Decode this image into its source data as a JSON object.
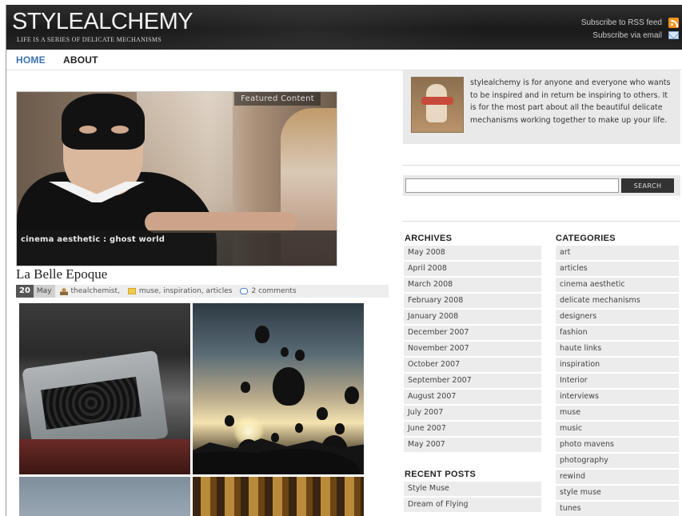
{
  "header": {
    "logo": "STYLEALCHEMY",
    "tagline": "LIFE IS A SERIES OF DELICATE MECHANISMS",
    "subscribe_rss": "Subscribe to RSS feed",
    "subscribe_email": "Subscribe via email",
    "icons": [
      "rss-icon",
      "mail-icon"
    ]
  },
  "nav": {
    "items": [
      {
        "label": "HOME"
      },
      {
        "label": "ABOUT"
      }
    ]
  },
  "featured": {
    "label": "Featured Content",
    "caption": "cinema aesthetic : ghost world"
  },
  "post": {
    "title": "La Belle Epoque",
    "day": "20",
    "month": "May",
    "author": "thealchemist,",
    "categories": "muse, inspiration, articles",
    "comments": "2 comments"
  },
  "sidebar": {
    "about_text": "stylealchemy is for anyone and everyone who wants to be inspired and in return be inspiring to others. It is for the most part about all the beautiful delicate mechanisms working together to make up your life.",
    "search": {
      "value": "",
      "placeholder": "",
      "button_label": "SEARCH"
    },
    "archives": {
      "title": "ARCHIVES",
      "items": [
        "May 2008",
        "April 2008",
        "March 2008",
        "February 2008",
        "January 2008",
        "December 2007",
        "November 2007",
        "October 2007",
        "September 2007",
        "August 2007",
        "July 2007",
        "June 2007",
        "May 2007"
      ]
    },
    "categories": {
      "title": "CATEGORIES",
      "items": [
        "art",
        "articles",
        "cinema aesthetic",
        "delicate mechanisms",
        "designers",
        "fashion",
        "haute links",
        "inspiration",
        "Interior",
        "interviews",
        "muse",
        "music",
        "photo mavens",
        "photography",
        "rewind",
        "style muse",
        "tunes"
      ]
    },
    "recent_posts": {
      "title": "RECENT POSTS",
      "items": [
        "Style Muse",
        "Dream of Flying"
      ]
    }
  },
  "colors": {
    "header_bg": "#1f1f1f",
    "nav_active": "#3a73ae",
    "sidebar_bg": "#ececec",
    "rss": "#f7931e"
  }
}
